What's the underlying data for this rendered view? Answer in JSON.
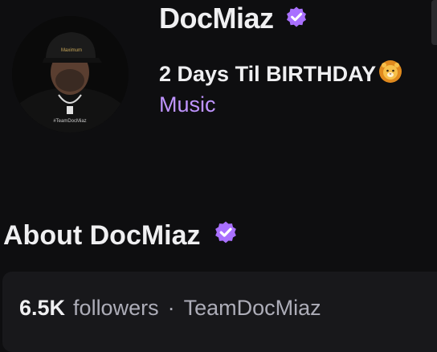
{
  "channel": {
    "name": "DocMiaz",
    "stream_title": "2 Days Til BIRTHDAY",
    "category": "Music",
    "avatar_shirt_text": "#TeamDocMiaz",
    "avatar_cap_text": "Maximum"
  },
  "about": {
    "heading": "About DocMiaz",
    "followers_count": "6.5K",
    "followers_label": "followers",
    "separator": "·",
    "team": "TeamDocMiaz"
  },
  "colors": {
    "background": "#0e0e10",
    "card": "#18181b",
    "accent": "#bf94ff",
    "verified": "#a970ff",
    "text": "#efeff1",
    "muted": "#adadb8"
  },
  "icons": {
    "verified": "verified-badge-icon",
    "title_emoji": "lion-face-icon"
  }
}
